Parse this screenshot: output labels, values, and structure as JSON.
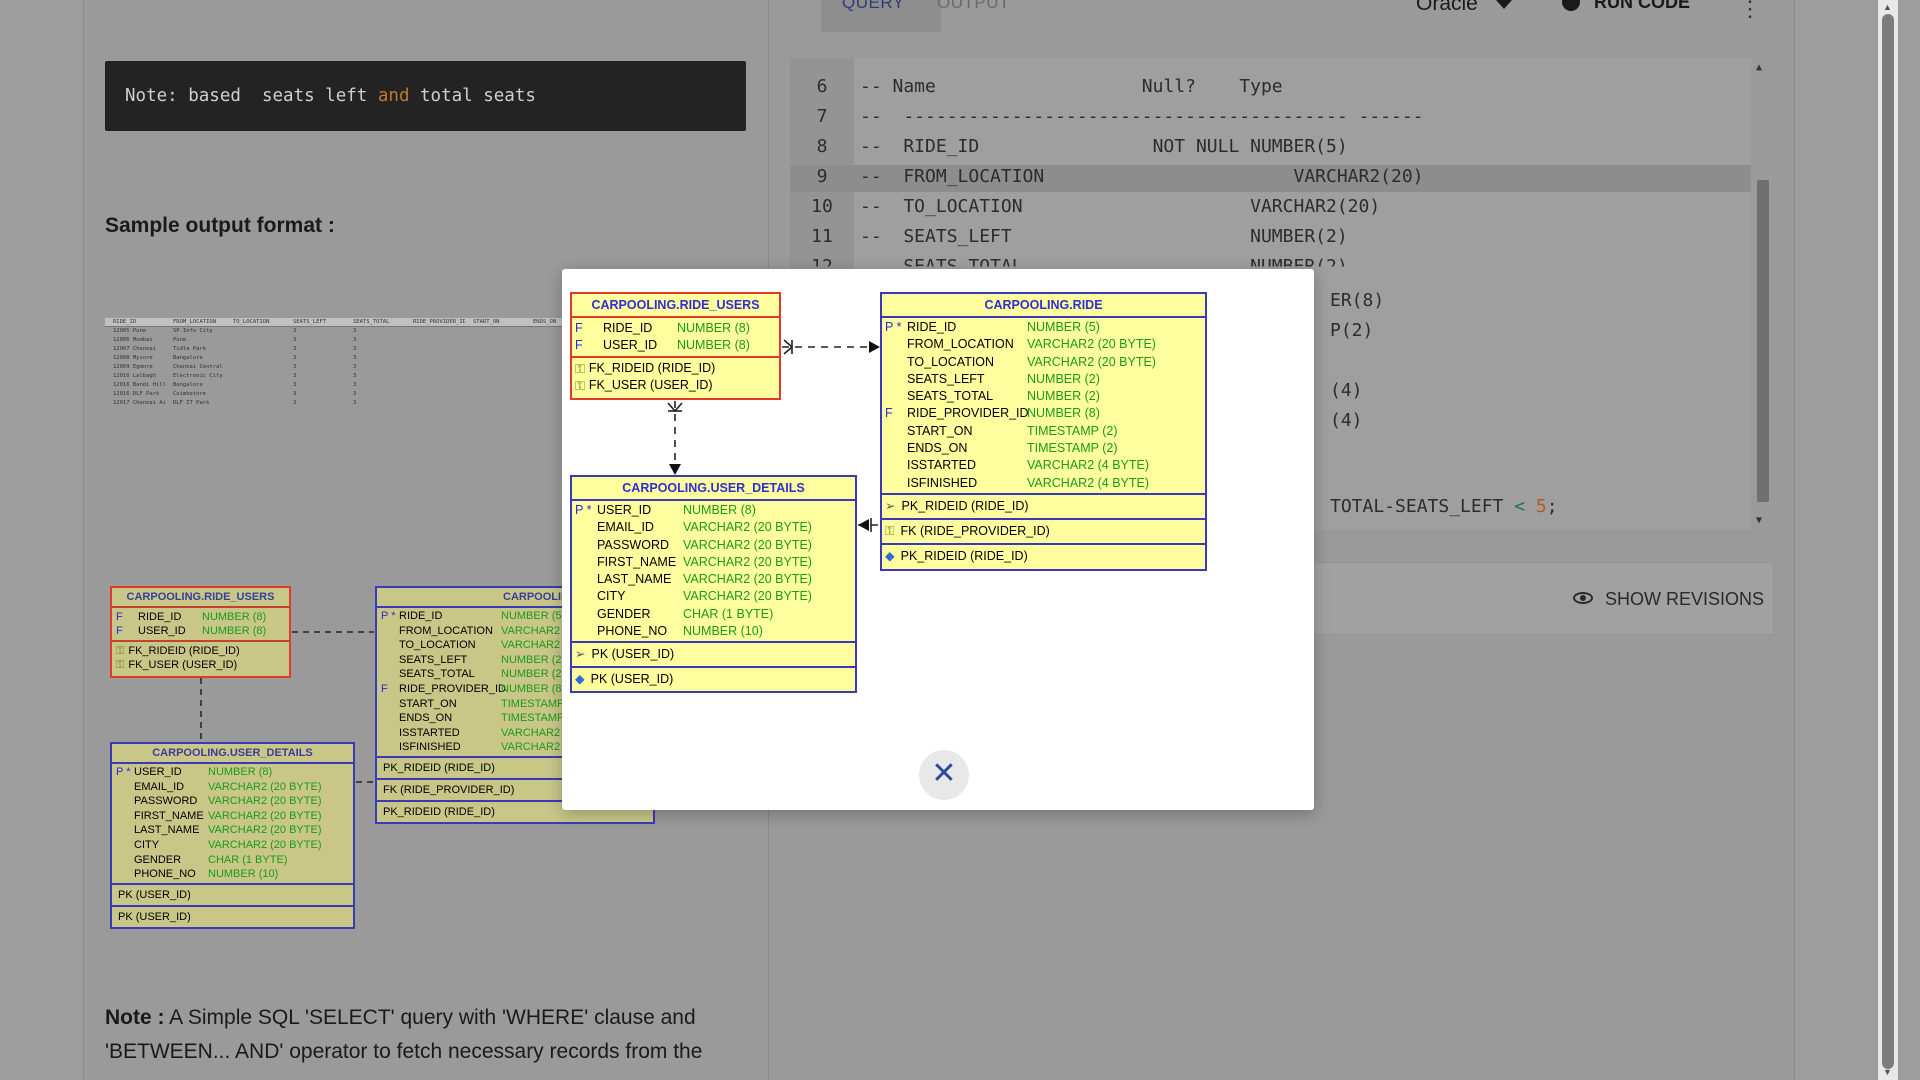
{
  "left": {
    "code_note": {
      "prefix": "Note: based  seats left ",
      "keyword": "and",
      "suffix": " total seats"
    },
    "sample_title": "Sample output format :",
    "sample_table": {
      "headers": [
        "RIDE_ID",
        "FROM_LOCATION",
        "TO_LOCATION",
        "SEATS_LEFT",
        "SEATS_TOTAL",
        "RIDE_PROVIDER_ID",
        "START_ON",
        "ENDS_ON"
      ],
      "rows": [
        [
          "12005 Pune",
          "SP Info City",
          "",
          "3",
          "3",
          "",
          "",
          ""
        ],
        [
          "12006 Mumbai",
          "Pune",
          "",
          "3",
          "3",
          "",
          "",
          ""
        ],
        [
          "12007 Chennai",
          "Tidle Park",
          "",
          "3",
          "3",
          "",
          "",
          ""
        ],
        [
          "12008 Mysore",
          "Bangalore",
          "",
          "3",
          "3",
          "",
          "",
          ""
        ],
        [
          "12009 Egmore",
          "Chennai Central",
          "",
          "3",
          "3",
          "",
          "",
          ""
        ],
        [
          "12010 Lalbagh",
          "Electronic City",
          "",
          "3",
          "3",
          "",
          "",
          ""
        ],
        [
          "12016 Bandi Hills",
          "Bangalore",
          "",
          "3",
          "3",
          "",
          "",
          ""
        ],
        [
          "12016 DLF Park",
          "Coimbatore",
          "",
          "3",
          "3",
          "",
          "",
          ""
        ],
        [
          "12017 Chennai Airport",
          "DLF IT Park",
          "",
          "3",
          "3",
          "",
          "",
          ""
        ]
      ]
    },
    "bottom_note": {
      "label": "Note :",
      "text": " A Simple SQL 'SELECT' query with 'WHERE' clause and 'BETWEEN... AND' operator to fetch necessary records from the"
    }
  },
  "erd": {
    "ride_users": {
      "title": "CARPOOLING.RIDE_USERS",
      "columns": [
        {
          "flag": "F",
          "name": "RIDE_ID",
          "type": "NUMBER (8)"
        },
        {
          "flag": "F",
          "name": "USER_ID",
          "type": "NUMBER (8)"
        }
      ],
      "keys": [
        "FK_RIDEID (RIDE_ID)",
        "FK_USER (USER_ID)"
      ]
    },
    "ride": {
      "title": "CARPOOLING.RIDE",
      "columns": [
        {
          "flag": "P *",
          "name": "RIDE_ID",
          "type": "NUMBER (5)"
        },
        {
          "flag": "",
          "name": "FROM_LOCATION",
          "type": "VARCHAR2 (20 BYTE)"
        },
        {
          "flag": "",
          "name": "TO_LOCATION",
          "type": "VARCHAR2 (20 BYTE)"
        },
        {
          "flag": "",
          "name": "SEATS_LEFT",
          "type": "NUMBER (2)"
        },
        {
          "flag": "",
          "name": "SEATS_TOTAL",
          "type": "NUMBER (2)"
        },
        {
          "flag": "F",
          "name": "RIDE_PROVIDER_ID",
          "type": "NUMBER (8)"
        },
        {
          "flag": "",
          "name": "START_ON",
          "type": "TIMESTAMP (2)"
        },
        {
          "flag": "",
          "name": "ENDS_ON",
          "type": "TIMESTAMP (2)"
        },
        {
          "flag": "",
          "name": "ISSTARTED",
          "type": "VARCHAR2 (4 BYTE)"
        },
        {
          "flag": "",
          "name": "ISFINISHED",
          "type": "VARCHAR2 (4 BYTE)"
        }
      ],
      "pk": "PK_RIDEID (RIDE_ID)",
      "fk": "FK (RIDE_PROVIDER_ID)",
      "idx": "PK_RIDEID (RIDE_ID)"
    },
    "user_details": {
      "title": "CARPOOLING.USER_DETAILS",
      "columns": [
        {
          "flag": "P *",
          "name": "USER_ID",
          "type": "NUMBER (8)"
        },
        {
          "flag": "",
          "name": "EMAIL_ID",
          "type": "VARCHAR2 (20 BYTE)"
        },
        {
          "flag": "",
          "name": "PASSWORD",
          "type": "VARCHAR2 (20 BYTE)"
        },
        {
          "flag": "",
          "name": "FIRST_NAME",
          "type": "VARCHAR2 (20 BYTE)"
        },
        {
          "flag": "",
          "name": "LAST_NAME",
          "type": "VARCHAR2 (20 BYTE)"
        },
        {
          "flag": "",
          "name": "CITY",
          "type": "VARCHAR2 (20 BYTE)"
        },
        {
          "flag": "",
          "name": "GENDER",
          "type": "CHAR (1 BYTE)"
        },
        {
          "flag": "",
          "name": "PHONE_NO",
          "type": "NUMBER (10)"
        }
      ],
      "pk": "PK (USER_ID)",
      "idx": "PK (USER_ID)"
    }
  },
  "editor": {
    "tabs": [
      "QUERY",
      "OUTPUT"
    ],
    "language": "Oracle",
    "run_label": "RUN CODE",
    "more_icon": "⋮",
    "lines": [
      {
        "n": "6",
        "text": "-- Name                   Null?    Type"
      },
      {
        "n": "7",
        "text": "--  ----------------------------------------- ------"
      },
      {
        "n": "8",
        "text": "--  RIDE_ID                NOT NULL NUMBER(5)"
      },
      {
        "n": "9",
        "text": "--  FROM_LOCATION                       VARCHAR2(20)"
      },
      {
        "n": "10",
        "text": "--  TO_LOCATION                     VARCHAR2(20)"
      },
      {
        "n": "11",
        "text": "--  SEATS_LEFT                      NUMBER(2)"
      },
      {
        "n": "12",
        "text": "--  SEATS_TOTAL                     NUMBER(2)"
      }
    ],
    "partial_fragments": [
      "ER(8)",
      "P(2)",
      "(4)",
      "(4)"
    ],
    "query_tail": {
      "text": "TOTAL-SEATS_LEFT ",
      "op": "<",
      "num": " 5",
      "end": ";"
    },
    "show_revisions": "SHOW REVISIONS"
  },
  "modal": {
    "close_icon": "✕"
  },
  "colors": {
    "accent": "#2f2fd0",
    "type_green": "#1b9a1b",
    "table_fill": "#fffe9f"
  }
}
